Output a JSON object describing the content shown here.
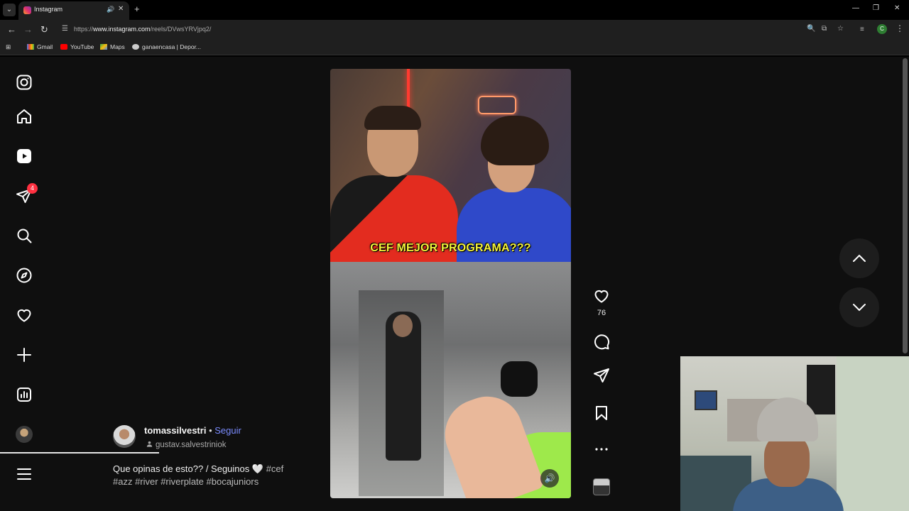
{
  "browser": {
    "tab_title": "Instagram",
    "url_prefix": "https://",
    "url_host": "www.instagram.com",
    "url_path": "/reels/DVwsYRVjpq2/",
    "profile_initial": "C",
    "bookmarks": [
      "Gmail",
      "YouTube",
      "Maps",
      "ganaencasa | Depor..."
    ]
  },
  "sidebar": {
    "messages_badge": "4"
  },
  "reel": {
    "overlay_text": "CEF MEJOR PROGRAMA???",
    "like_count": "76",
    "author": "tomassilvestri",
    "separator": "•",
    "follow_label": "Seguir",
    "collaborator": "gustav.salvestriniok",
    "caption_text": "Que opinas de esto?? / Seguinos 🤍",
    "hashtags_line1": "#cef",
    "hashtags_line2": "#azz #river #riverplate #bocajuniors"
  },
  "colors": {
    "background": "#0f0f0f",
    "follow_link": "#7b8cff",
    "badge": "#ff3040",
    "overlay_text": "#f4f33a"
  }
}
